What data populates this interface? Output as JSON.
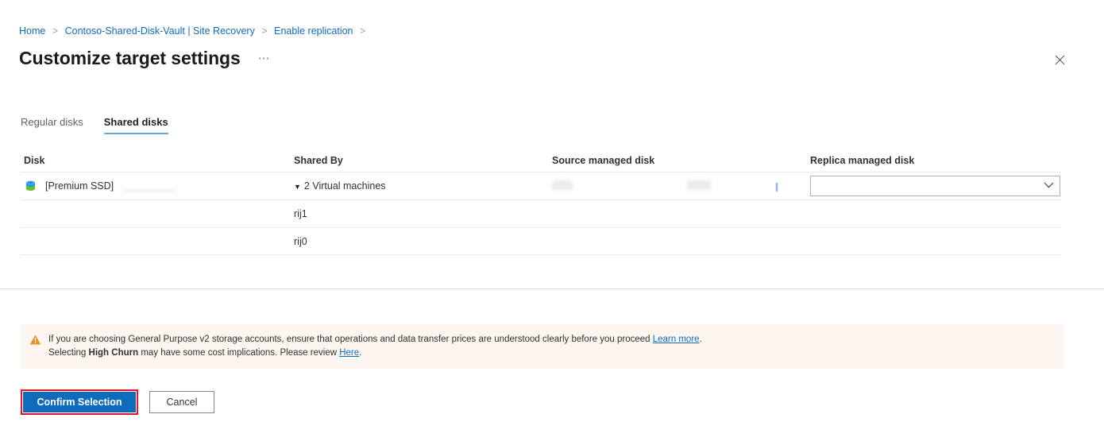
{
  "breadcrumb": {
    "items": [
      "Home",
      "Contoso-Shared-Disk-Vault | Site Recovery",
      "Enable replication"
    ],
    "separator": ">",
    "trailing_separator": ">"
  },
  "header": {
    "title": "Customize target settings",
    "overflow_label": "⋯",
    "close_label": "✕"
  },
  "tabs": [
    {
      "label": "Regular disks",
      "active": false
    },
    {
      "label": "Shared disks",
      "active": true
    }
  ],
  "table": {
    "columns": [
      "Disk",
      "Shared By",
      "Source managed disk",
      "Replica managed disk"
    ],
    "rows": [
      {
        "disk_icon": "managed-disk-icon",
        "disk": "[Premium SSD]",
        "disk_suffix_redacted": "__________",
        "shared_by_expander": "▼",
        "shared_by": "2 Virtual machines",
        "source_managed_disk": "",
        "replica_managed_disk": "",
        "has_dropdown": true
      },
      {
        "disk": "",
        "shared_by": "rij1",
        "source_managed_disk": "",
        "replica_managed_disk": "",
        "has_dropdown": false
      },
      {
        "disk": "",
        "shared_by": "rij0",
        "source_managed_disk": "",
        "replica_managed_disk": "",
        "has_dropdown": false
      }
    ]
  },
  "warning": {
    "icon": "warning-triangle-icon",
    "line1_part1": "If you are choosing General Purpose v2 storage accounts, ensure that operations and data transfer prices are understood clearly before you proceed ",
    "line1_link": "Learn more",
    "line1_part2": ".",
    "line2_part1": "Selecting ",
    "line2_bold": "High Churn",
    "line2_part2": " may have some cost implications. Please review ",
    "line2_link": "Here",
    "line2_part3": "."
  },
  "footer": {
    "confirm_label": "Confirm Selection",
    "cancel_label": "Cancel"
  },
  "colors": {
    "accent_blue": "#0f6cbd",
    "link_blue": "#0f6cbd",
    "tab_underline": "#6aa9e0",
    "warning_bg": "#fdf6f0",
    "warning_icon": "#e8921f",
    "annotation_red": "#e8112d",
    "disk_icon_top": "#2196f3",
    "disk_icon_bottom": "#5ec22e"
  }
}
